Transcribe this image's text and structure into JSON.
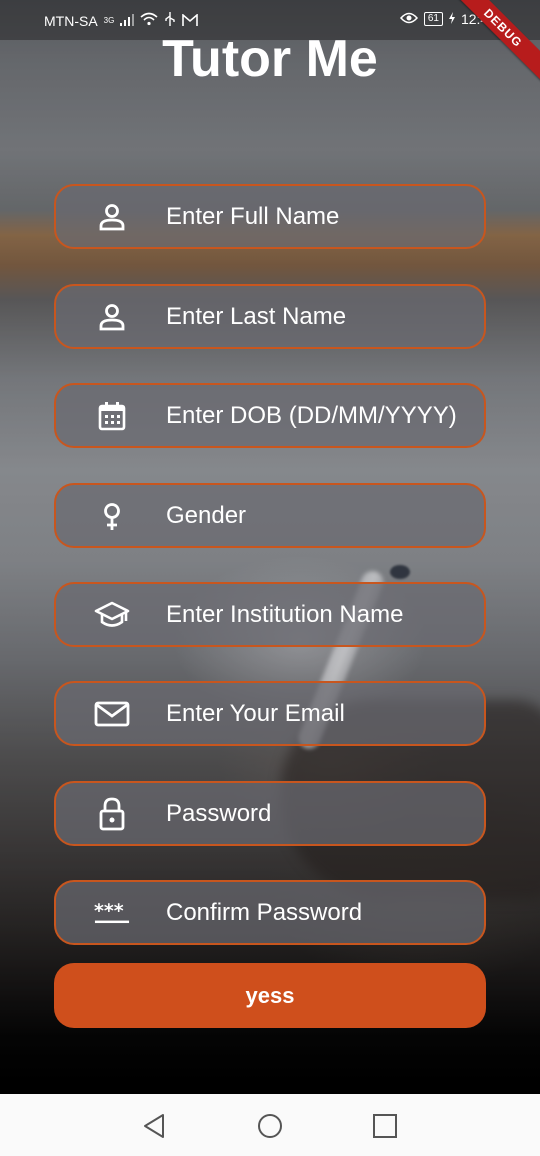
{
  "status_bar": {
    "carrier": "MTN-SA",
    "network": "3G",
    "battery": "61",
    "time": "12:46",
    "debug_banner": "DEBUG"
  },
  "app": {
    "title": "Tutor Me"
  },
  "form": {
    "fields": [
      {
        "label": "Enter Full Name",
        "icon": "person-icon"
      },
      {
        "label": "Enter Last Name",
        "icon": "person-icon"
      },
      {
        "label": "Enter DOB (DD/MM/YYYY)",
        "icon": "calendar-icon"
      },
      {
        "label": "Gender",
        "icon": "female-icon"
      },
      {
        "label": "Enter Institution Name",
        "icon": "graduation-cap-icon"
      },
      {
        "label": "Enter Your Email",
        "icon": "mail-icon"
      },
      {
        "label": "Password",
        "icon": "lock-icon"
      },
      {
        "label": "Confirm Password",
        "icon": "password-dots-icon"
      }
    ],
    "submit_label": "yess"
  },
  "colors": {
    "accent": "#cf4f1c",
    "field_border": "#c8561e"
  },
  "nav_bar": {
    "back": "back-icon",
    "home": "home-icon",
    "recents": "recents-icon"
  }
}
